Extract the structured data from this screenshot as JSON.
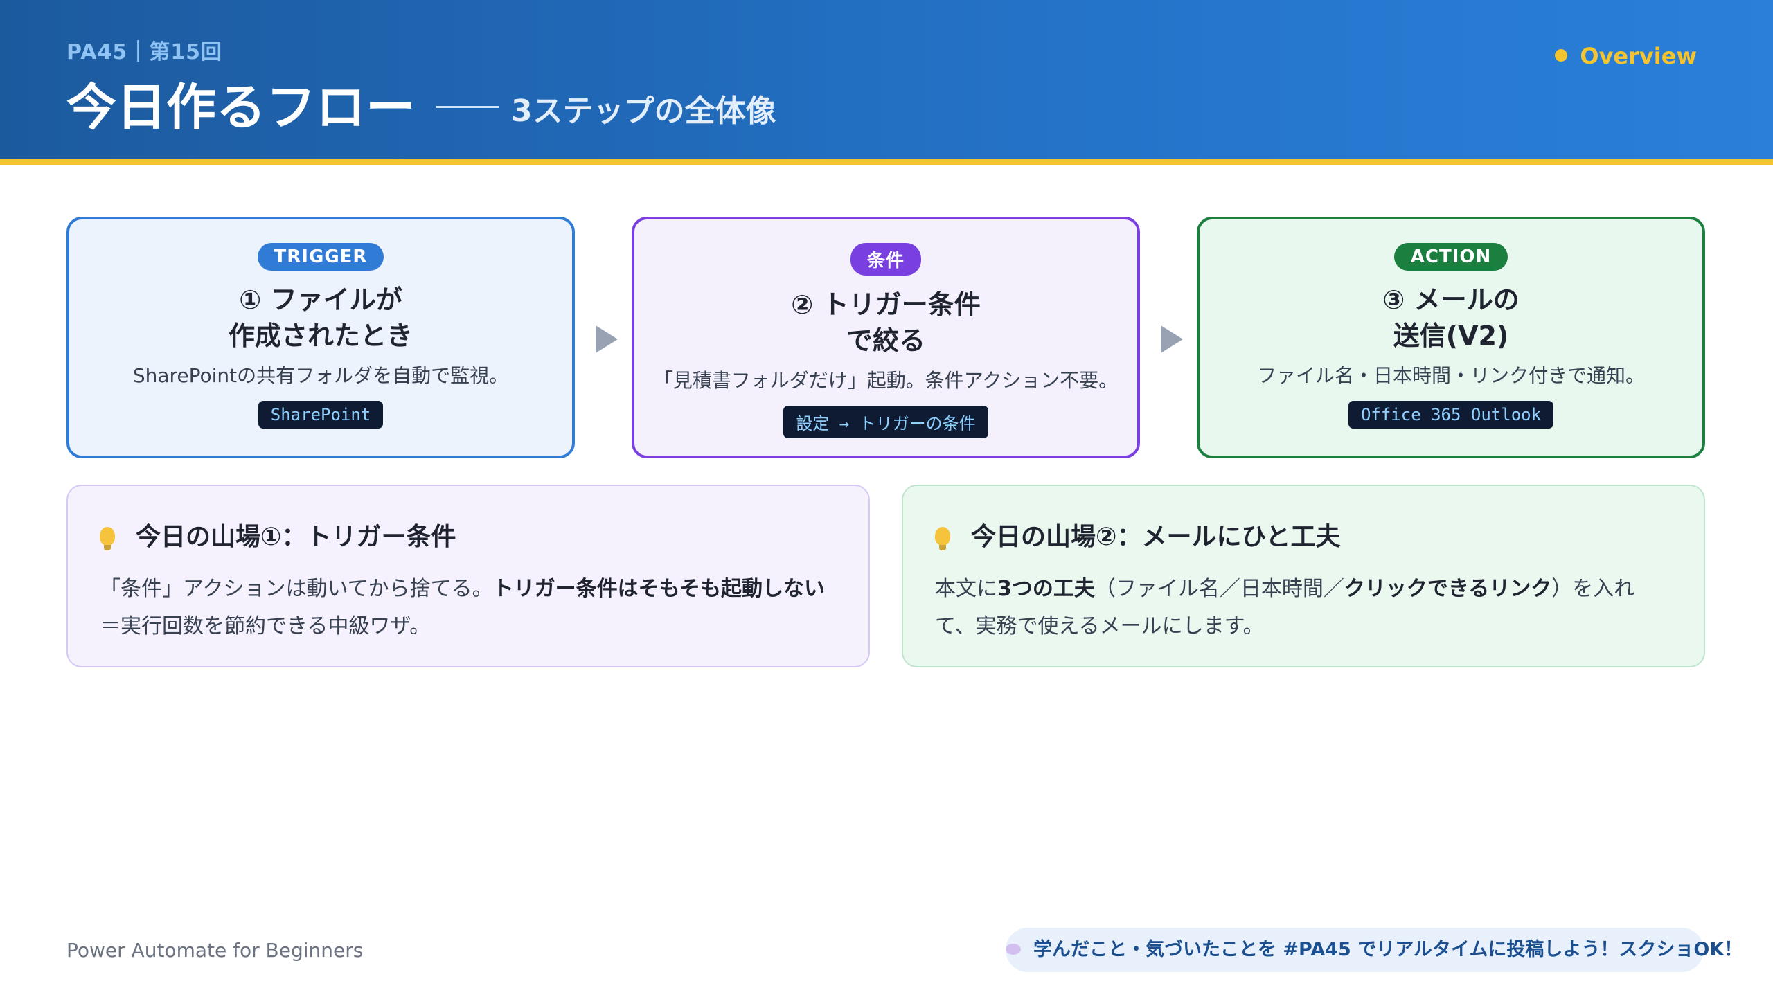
{
  "header": {
    "session": "PA45｜第15回",
    "title": "今日作るフロー",
    "subtitle": "3ステップの全体像",
    "overview_label": "Overview"
  },
  "steps": [
    {
      "tag": "TRIGGER",
      "title_line1": "① ファイルが",
      "title_line2": "作成されたとき",
      "desc": "SharePointの共有フォルダを自動で監視。",
      "code": "SharePoint"
    },
    {
      "tag": "条件",
      "title_line1": "② トリガー条件",
      "title_line2": "で絞る",
      "desc": "「見積書フォルダだけ」起動。条件アクション不要。",
      "code": "設定 → トリガーの条件"
    },
    {
      "tag": "ACTION",
      "title_line1": "③ メールの",
      "title_line2": "送信(V2)",
      "desc": "ファイル名・日本時間・リンク付きで通知。",
      "code": "Office 365 Outlook"
    }
  ],
  "tips": [
    {
      "title": "今日の山場①：トリガー条件",
      "body_pre": "「条件」アクションは動いてから捨てる。",
      "body_bold": "トリガー条件はそもそも起動しない",
      "body_post": "＝実行回数を節約できる中級ワザ。"
    },
    {
      "title": "今日の山場②：メールにひと工夫",
      "body_pre": "本文に",
      "body_bold1": "3つの工夫",
      "body_mid": "（ファイル名／日本時間／",
      "body_bold2": "クリックできるリンク",
      "body_post": "）を入れて、実務で使えるメールにします。"
    }
  ],
  "footer": {
    "brand": "Power Automate for Beginners",
    "cta": "学んだこと・気づいたことを #PA45 でリアルタイムに投稿しよう！スクショOK！"
  },
  "colors": {
    "header_blue": "#2473c9",
    "accent_yellow": "#f4c430",
    "trigger_blue": "#2f7bd6",
    "condition_purple": "#7a3fe0",
    "action_green": "#1a7f3f"
  }
}
